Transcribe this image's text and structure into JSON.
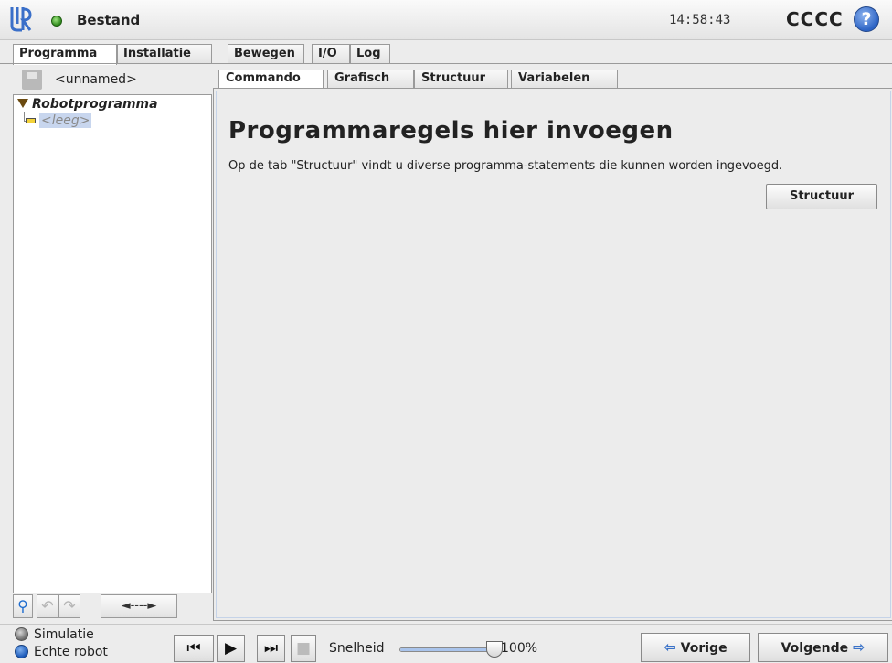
{
  "app": {
    "title": "Bestand",
    "clock": "14:58:43",
    "robot_name": "CCCC",
    "help_glyph": "?",
    "status_color": "#2f8a1c",
    "accent_color": "#2c63c4"
  },
  "main_tabs": [
    {
      "label": "Programma",
      "active": true
    },
    {
      "label": "Installatie",
      "active": false
    },
    {
      "label": "Bewegen",
      "active": false
    },
    {
      "label": "I/O",
      "active": false
    },
    {
      "label": "Log",
      "active": false
    }
  ],
  "left_panel": {
    "file_name": "<unnamed>",
    "tree": {
      "root": "Robotprogramma",
      "child": "<leeg>"
    },
    "toolbar": {
      "search_icon": "search-icon",
      "undo_icon": "undo-icon",
      "redo_icon": "redo-icon",
      "move_glyph": "◄----►"
    }
  },
  "sub_tabs": [
    {
      "label": "Commando",
      "active": true
    },
    {
      "label": "Grafisch",
      "active": false
    },
    {
      "label": "Structuur",
      "active": false
    },
    {
      "label": "Variabelen",
      "active": false
    }
  ],
  "content": {
    "title": "Programmaregels hier invoegen",
    "description": "Op de tab \"Structuur\" vindt u diverse programma-statements die kunnen worden ingevoegd.",
    "structure_button": "Structuur"
  },
  "bottom": {
    "mode_simulation": "Simulatie",
    "mode_real": "Echte robot",
    "speed_label": "Snelheid",
    "speed_value": "100%",
    "speed_fraction": 1.0,
    "prev_label": "Vorige",
    "next_label": "Volgende"
  }
}
